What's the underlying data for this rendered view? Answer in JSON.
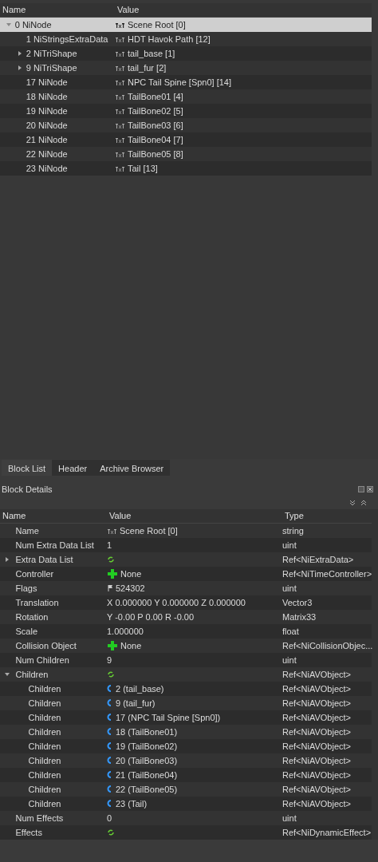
{
  "block_list": {
    "columns": [
      "Name",
      "Value"
    ],
    "nodes": [
      {
        "name": "0 NiNode",
        "value": "Scene Root [0]",
        "kind": "txt-bold",
        "selected": true,
        "expanded": true,
        "children": [
          {
            "name": "1 NiStringsExtraData",
            "value": "HDT Havok Path [12]",
            "kind": "txt",
            "selected": false
          },
          {
            "name": "2 NiTriShape",
            "value": "tail_base [1]",
            "kind": "txt",
            "selected": false,
            "expanded": false
          },
          {
            "name": "9 NiTriShape",
            "value": "tail_fur [2]",
            "kind": "txt",
            "selected": false,
            "expanded": false
          },
          {
            "name": "17 NiNode",
            "value": "NPC Tail Spine [Spn0] [14]",
            "kind": "txt",
            "selected": false
          },
          {
            "name": "18 NiNode",
            "value": "TailBone01 [4]",
            "kind": "txt",
            "selected": false
          },
          {
            "name": "19 NiNode",
            "value": "TailBone02 [5]",
            "kind": "txt",
            "selected": false
          },
          {
            "name": "20 NiNode",
            "value": "TailBone03 [6]",
            "kind": "txt",
            "selected": false
          },
          {
            "name": "21 NiNode",
            "value": "TailBone04 [7]",
            "kind": "txt",
            "selected": false
          },
          {
            "name": "22 NiNode",
            "value": "TailBone05 [8]",
            "kind": "txt",
            "selected": false
          },
          {
            "name": "23 NiNode",
            "value": "Tail [13]",
            "kind": "txt",
            "selected": false
          }
        ]
      }
    ]
  },
  "tabs": [
    {
      "label": "Block List",
      "selected": true
    },
    {
      "label": "Header",
      "selected": false
    },
    {
      "label": "Archive Browser",
      "selected": false
    }
  ],
  "block_details": {
    "title": "Block Details",
    "columns": [
      "Name",
      "Value",
      "Type"
    ],
    "rows": [
      {
        "name": "Name",
        "value": "Scene Root [0]",
        "kind": "txt",
        "type": "string"
      },
      {
        "name": "Num Extra Data List",
        "value": "1",
        "type": "uint"
      },
      {
        "name": "Extra Data List",
        "kind": "cycle",
        "type": "Ref<NiExtraData>",
        "expanded": false
      },
      {
        "name": "Controller",
        "value": "None",
        "kind": "plus",
        "type": "Ref<NiTimeController>"
      },
      {
        "name": "Flags",
        "value": "524302",
        "kind": "flag",
        "type": "uint"
      },
      {
        "name": "Translation",
        "value": "X 0.000000 Y 0.000000 Z 0.000000",
        "type": "Vector3"
      },
      {
        "name": "Rotation",
        "value": "Y -0.00 P 0.00 R -0.00",
        "type": "Matrix33"
      },
      {
        "name": "Scale",
        "value": "1.000000",
        "type": "float"
      },
      {
        "name": "Collision Object",
        "value": "None",
        "kind": "plus",
        "type": "Ref<NiCollisionObjec..."
      },
      {
        "name": "Num Children",
        "value": "9",
        "type": "uint"
      },
      {
        "name": "Children",
        "kind": "cycle",
        "type": "Ref<NiAVObject>",
        "expanded": true,
        "children": [
          {
            "name": "Children",
            "value": "2 (tail_base)",
            "kind": "link",
            "type": "Ref<NiAVObject>"
          },
          {
            "name": "Children",
            "value": "9 (tail_fur)",
            "kind": "link",
            "type": "Ref<NiAVObject>"
          },
          {
            "name": "Children",
            "value": "17 (NPC Tail Spine [Spn0])",
            "kind": "link",
            "type": "Ref<NiAVObject>"
          },
          {
            "name": "Children",
            "value": "18 (TailBone01)",
            "kind": "link",
            "type": "Ref<NiAVObject>"
          },
          {
            "name": "Children",
            "value": "19 (TailBone02)",
            "kind": "link",
            "type": "Ref<NiAVObject>"
          },
          {
            "name": "Children",
            "value": "20 (TailBone03)",
            "kind": "link",
            "type": "Ref<NiAVObject>"
          },
          {
            "name": "Children",
            "value": "21 (TailBone04)",
            "kind": "link",
            "type": "Ref<NiAVObject>"
          },
          {
            "name": "Children",
            "value": "22 (TailBone05)",
            "kind": "link",
            "type": "Ref<NiAVObject>"
          },
          {
            "name": "Children",
            "value": "23 (Tail)",
            "kind": "link",
            "type": "Ref<NiAVObject>"
          }
        ]
      },
      {
        "name": "Num Effects",
        "value": "0",
        "type": "uint"
      },
      {
        "name": "Effects",
        "kind": "cycle",
        "type": "Ref<NiDynamicEffect>"
      }
    ]
  }
}
